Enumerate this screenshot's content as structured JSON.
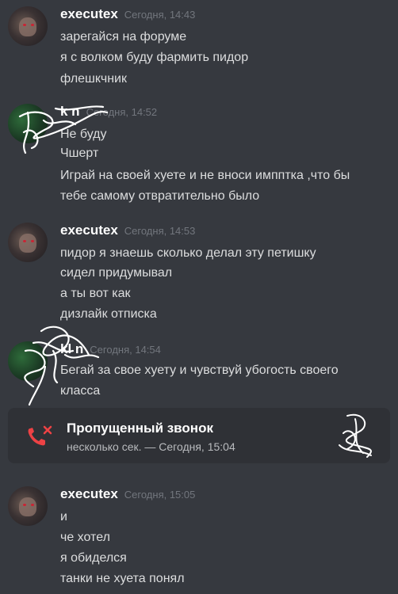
{
  "messages": [
    {
      "author": "executex",
      "timestamp": "Сегодня, 14:43",
      "avatar_icon": "hacker-avatar-icon",
      "lines": [
        "зарегайся на форуме",
        "я с волком буду фармить пидор",
        "флешкчник"
      ]
    },
    {
      "author": "k    n",
      "timestamp": "Сегодня, 14:52",
      "avatar_icon": "redacted-avatar-icon",
      "lines": [
        "Не буду",
        "Чшерт",
        "Играй на своей хуете и не вноси импптка ,что бы",
        "тебе самому отвратительно было"
      ]
    },
    {
      "author": "executex",
      "timestamp": "Сегодня, 14:53",
      "avatar_icon": "hacker-avatar-icon",
      "lines": [
        "пидор я знаешь сколько делал эту петишку",
        "сидел придумывал",
        "а ты вот как",
        "дизлайк отписка"
      ]
    },
    {
      "author": "kl   n",
      "timestamp": "Сегодня, 14:54",
      "avatar_icon": "redacted-avatar-icon",
      "lines": [
        "Бегай за свое хуету и чувствуй убогость своего",
        "класса"
      ]
    },
    {
      "author": "executex",
      "timestamp": "Сегодня, 15:05",
      "avatar_icon": "hacker-avatar-icon",
      "lines": [
        "и",
        "че хотел",
        "я обиделся",
        "танки не хуета понял"
      ]
    }
  ],
  "call": {
    "title": "Пропущенный звонок",
    "subtitle": "несколько сек. — Сегодня, 15:04",
    "icon": "missed-call-icon",
    "icon_color": "#ed4245"
  },
  "colors": {
    "background": "#36393f",
    "card": "#2f3136",
    "username": "#ffffff",
    "timestamp": "#72767d",
    "text": "#dcddde"
  }
}
